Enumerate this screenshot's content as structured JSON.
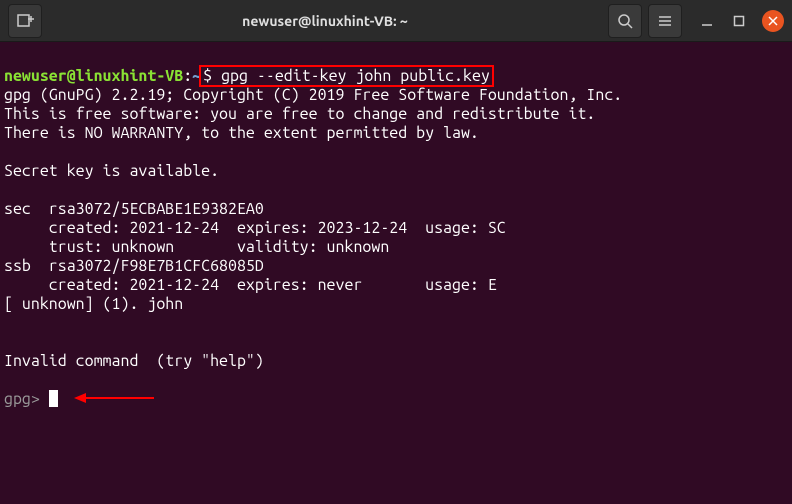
{
  "titlebar": {
    "title": "newuser@linuxhint-VB: ~"
  },
  "terminal": {
    "prompt_user": "newuser@linuxhint-VB",
    "prompt_sep": ":",
    "prompt_path": "~",
    "prompt_symbol": "$",
    "command": " gpg --edit-key john public.key",
    "lines": {
      "l1": "gpg (GnuPG) 2.2.19; Copyright (C) 2019 Free Software Foundation, Inc.",
      "l2": "This is free software: you are free to change and redistribute it.",
      "l3": "There is NO WARRANTY, to the extent permitted by law.",
      "l4": "",
      "l5": "Secret key is available.",
      "l6": "",
      "l7": "sec  rsa3072/5ECBABE1E9382EA0",
      "l8": "     created: 2021-12-24  expires: 2023-12-24  usage: SC  ",
      "l9": "     trust: unknown       validity: unknown",
      "l10": "ssb  rsa3072/F98E7B1CFC68085D",
      "l11": "     created: 2021-12-24  expires: never       usage: E   ",
      "l12": "[ unknown] (1). john",
      "l13": "",
      "l14": "",
      "l15": "Invalid command  (try \"help\")",
      "l16": ""
    },
    "gpg_prompt": "gpg> "
  },
  "icons": {
    "newtab": "newtab-icon",
    "search": "search-icon",
    "menu": "hamburger-icon",
    "minimize": "minimize-icon",
    "maximize": "maximize-icon",
    "close": "close-icon"
  }
}
